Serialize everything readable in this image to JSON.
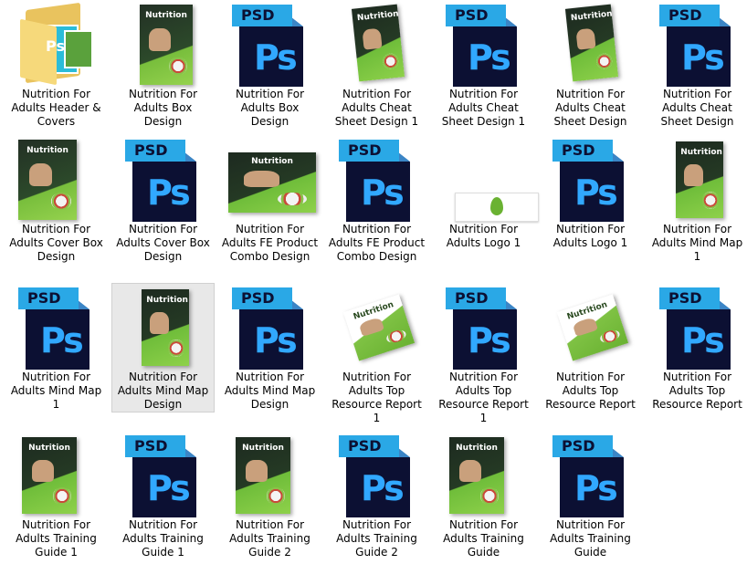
{
  "files": [
    {
      "label": "Nutrition For Adults Header & Covers",
      "icon": "folder-icon"
    },
    {
      "label": "Nutrition For Adults Box Design",
      "icon": "box-cover-thumbnail"
    },
    {
      "label": "Nutrition For Adults Box Design",
      "icon": "psd-file-icon"
    },
    {
      "label": "Nutrition For Adults Cheat Sheet Design 1",
      "icon": "cheat-sheet-thumbnail"
    },
    {
      "label": "Nutrition For Adults Cheat Sheet Design 1",
      "icon": "psd-file-icon"
    },
    {
      "label": "Nutrition For Adults Cheat Sheet Design",
      "icon": "cheat-sheet-thumbnail"
    },
    {
      "label": "Nutrition For Adults Cheat Sheet Design",
      "icon": "psd-file-icon"
    },
    {
      "label": "Nutrition For Adults Cover Box Design",
      "icon": "cover-box-thumbnail"
    },
    {
      "label": "Nutrition For Adults Cover Box Design",
      "icon": "psd-file-icon"
    },
    {
      "label": "Nutrition For Adults FE Product Combo Design",
      "icon": "combo-thumbnail"
    },
    {
      "label": "Nutrition For Adults FE Product Combo Design",
      "icon": "psd-file-icon"
    },
    {
      "label": "Nutrition For Adults Logo 1",
      "icon": "logo-thumbnail"
    },
    {
      "label": "Nutrition For Adults Logo 1",
      "icon": "psd-file-icon"
    },
    {
      "label": "Nutrition For Adults Mind Map 1",
      "icon": "mind-map-thumbnail"
    },
    {
      "label": "Nutrition For Adults Mind Map 1",
      "icon": "psd-file-icon"
    },
    {
      "label": "Nutrition For Adults Mind Map Design",
      "icon": "mind-map-thumbnail",
      "selected": true
    },
    {
      "label": "Nutrition For Adults Mind Map Design",
      "icon": "psd-file-icon"
    },
    {
      "label": "Nutrition For Adults Top Resource Report 1",
      "icon": "report-thumbnail"
    },
    {
      "label": "Nutrition For Adults Top Resource Report 1",
      "icon": "psd-file-icon"
    },
    {
      "label": "Nutrition For Adults Top Resource Report",
      "icon": "report-thumbnail"
    },
    {
      "label": "Nutrition For Adults Top Resource Report",
      "icon": "psd-file-icon"
    },
    {
      "label": "Nutrition For Adults Training Guide 1",
      "icon": "training-guide-thumbnail"
    },
    {
      "label": "Nutrition For Adults Training Guide 1",
      "icon": "psd-file-icon"
    },
    {
      "label": "Nutrition For Adults Training Guide 2",
      "icon": "training-guide-thumbnail"
    },
    {
      "label": "Nutrition For Adults Training Guide 2",
      "icon": "psd-file-icon"
    },
    {
      "label": "Nutrition For Adults Training Guide",
      "icon": "training-guide-thumbnail"
    },
    {
      "label": "Nutrition For Adults Training Guide",
      "icon": "psd-file-icon"
    }
  ],
  "psd_badge": "PSD",
  "ps_glyph": "Ps",
  "colors": {
    "psd_page": "#0c1033",
    "psd_tag": "#2aa8e6",
    "ps_text": "#31a8ff",
    "selection": "#e8e8e8"
  }
}
